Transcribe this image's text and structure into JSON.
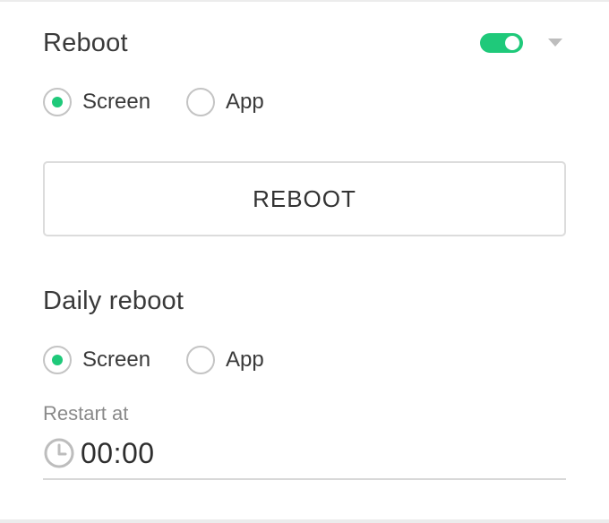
{
  "colors": {
    "accent": "#1fc97a",
    "border": "#dcdcdc",
    "muted": "#8a8a8a"
  },
  "reboot": {
    "title": "Reboot",
    "toggle_on": true,
    "options": [
      {
        "label": "Screen",
        "checked": true
      },
      {
        "label": "App",
        "checked": false
      }
    ],
    "button_label": "REBOOT"
  },
  "daily_reboot": {
    "title": "Daily reboot",
    "options": [
      {
        "label": "Screen",
        "checked": true
      },
      {
        "label": "App",
        "checked": false
      }
    ],
    "restart_label": "Restart at",
    "restart_time": "00:00"
  },
  "icons": {
    "time": "clock-icon",
    "expand": "chevron-down-icon"
  }
}
